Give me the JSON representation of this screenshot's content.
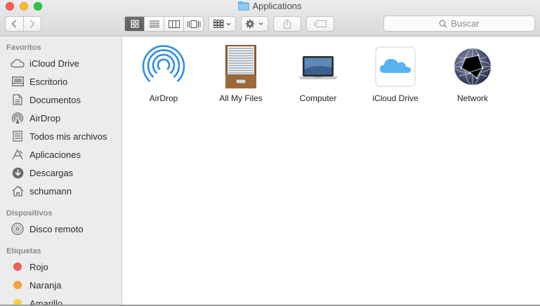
{
  "window": {
    "title": "Applications",
    "folder_icon": "folder-icon"
  },
  "toolbar": {
    "back_icon": "chevron-left-icon",
    "forward_icon": "chevron-right-icon",
    "views": [
      {
        "name": "icon-view-icon",
        "active": true
      },
      {
        "name": "list-view-icon",
        "active": false
      },
      {
        "name": "column-view-icon",
        "active": false
      },
      {
        "name": "cover-flow-view-icon",
        "active": false
      }
    ],
    "arrange_icon": "arrange-grid-icon",
    "action_icon": "gear-icon",
    "share_icon": "share-icon",
    "tag_icon": "tag-icon",
    "search_placeholder": "Buscar"
  },
  "sidebar": {
    "favorites_title": "Favoritos",
    "favorites": [
      {
        "label": "iCloud Drive",
        "icon": "cloud-icon"
      },
      {
        "label": "Escritorio",
        "icon": "desktop-icon"
      },
      {
        "label": "Documentos",
        "icon": "document-icon"
      },
      {
        "label": "AirDrop",
        "icon": "airdrop-icon"
      },
      {
        "label": "Todos mis archivos",
        "icon": "all-files-icon"
      },
      {
        "label": "Aplicaciones",
        "icon": "applications-icon"
      },
      {
        "label": "Descargas",
        "icon": "download-icon"
      },
      {
        "label": "schumann",
        "icon": "home-icon"
      }
    ],
    "devices_title": "Dispositivos",
    "devices": [
      {
        "label": "Disco remoto",
        "icon": "disc-icon"
      }
    ],
    "tags_title": "Etiquetas",
    "tags": [
      {
        "label": "Rojo",
        "color": "#f25c58"
      },
      {
        "label": "Naranja",
        "color": "#f5a33b"
      },
      {
        "label": "Amarillo",
        "color": "#f5cf3f"
      }
    ]
  },
  "content": {
    "items": [
      {
        "label": "AirDrop",
        "icon": "airdrop-large-icon"
      },
      {
        "label": "All My Files",
        "icon": "file-cabinet-icon"
      },
      {
        "label": "Computer",
        "icon": "laptop-icon"
      },
      {
        "label": "iCloud Drive",
        "icon": "icloud-drive-icon"
      },
      {
        "label": "Network",
        "icon": "network-globe-icon"
      }
    ]
  },
  "colors": {
    "accent": "#2f8ee6",
    "sidebar_bg": "#ececec"
  }
}
